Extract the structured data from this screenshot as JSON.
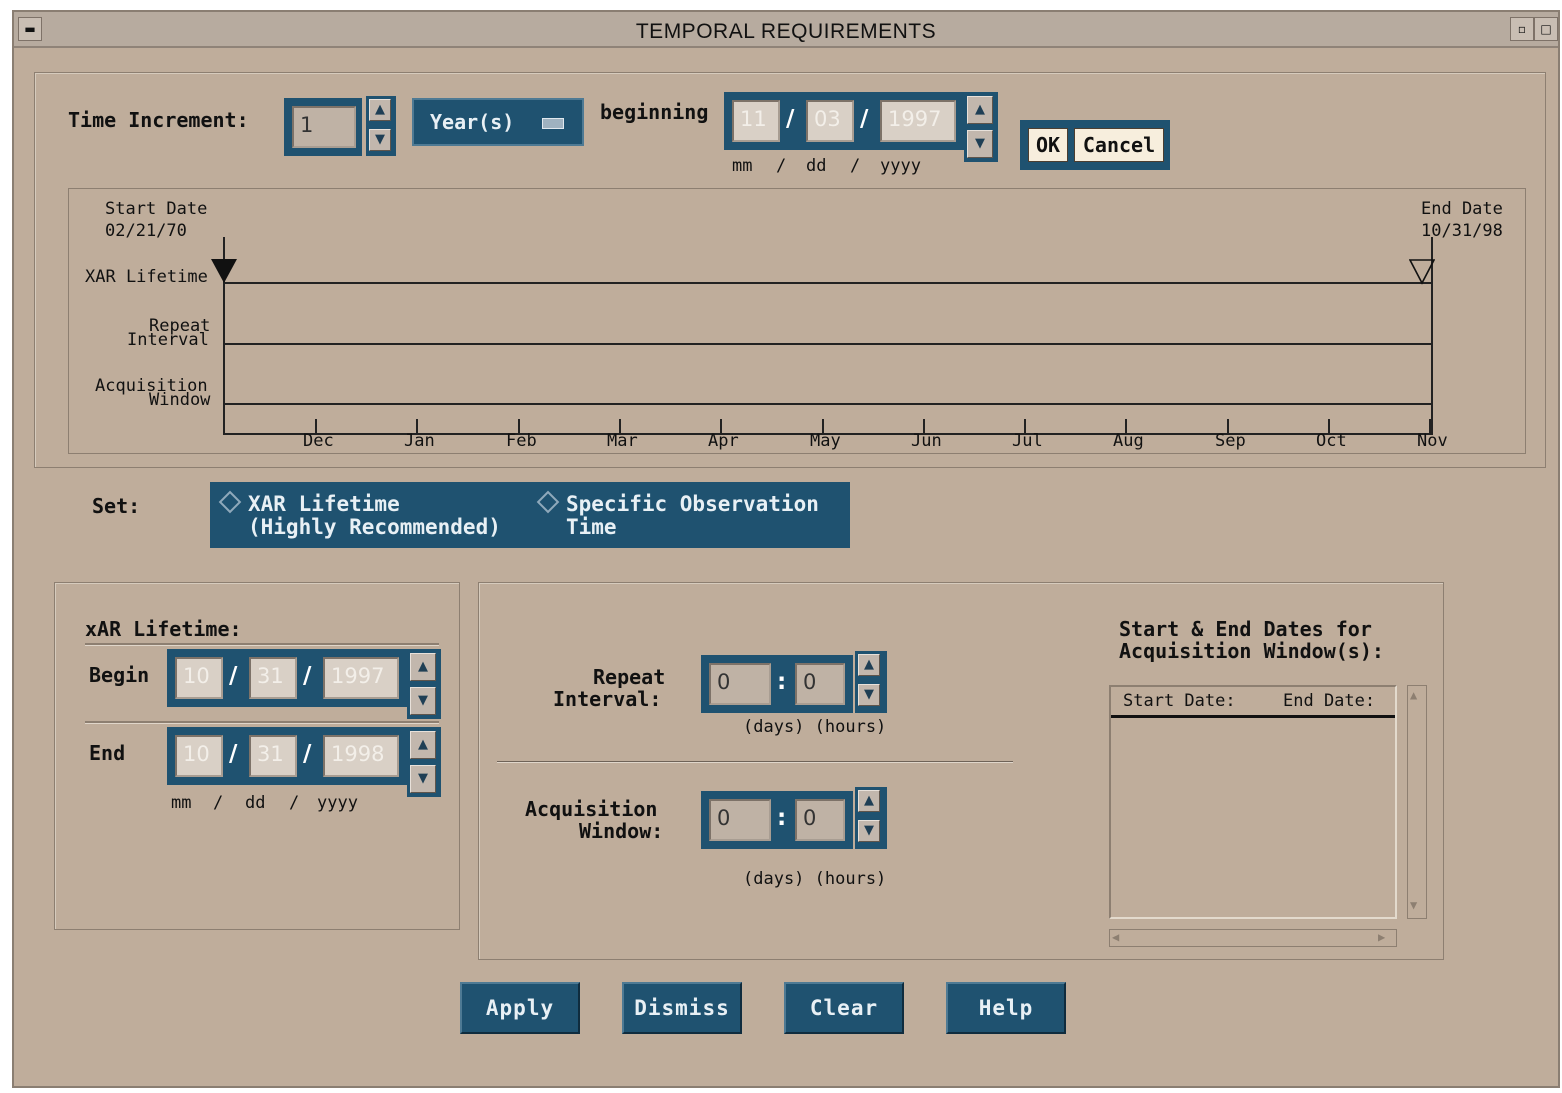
{
  "window": {
    "title": "TEMPORAL REQUIREMENTS"
  },
  "time_increment": {
    "label": "Time Increment:",
    "value": "1",
    "unit_selector": "Year(s)",
    "beginning_label": "beginning",
    "mm": "11",
    "dd": "03",
    "yyyy": "1997",
    "date_format": {
      "mm": "mm",
      "dd": "dd",
      "yyyy": "yyyy"
    },
    "ok_label": "OK",
    "cancel_label": "Cancel"
  },
  "timeline": {
    "start_label": "Start Date",
    "start_date": "02/21/70",
    "end_label": "End Date",
    "end_date": "10/31/98",
    "rows": {
      "lifetime": "XAR Lifetime",
      "repeat_1": "Repeat",
      "repeat_2": "Interval",
      "acq_1": "Acquisition",
      "acq_2": "Window"
    },
    "months": [
      "Dec",
      "Jan",
      "Feb",
      "Mar",
      "Apr",
      "May",
      "Jun",
      "Jul",
      "Aug",
      "Sep",
      "Oct",
      "Nov"
    ]
  },
  "set": {
    "label": "Set:",
    "option1_line1": "XAR Lifetime",
    "option1_line2": "(Highly Recommended)",
    "option2_line1": "Specific Observation",
    "option2_line2": "Time"
  },
  "lifetime": {
    "title": "xAR Lifetime:",
    "begin_label": "Begin",
    "end_label": "End",
    "begin": {
      "mm": "10",
      "dd": "31",
      "yyyy": "1997"
    },
    "end": {
      "mm": "10",
      "dd": "31",
      "yyyy": "1998"
    },
    "format": {
      "mm": "mm",
      "dd": "dd",
      "yyyy": "yyyy"
    }
  },
  "repeat": {
    "label1": "Repeat",
    "label2": "Interval:",
    "days": "0",
    "hours": "0",
    "units": "(days) (hours)"
  },
  "acquisition": {
    "label1": "Acquisition",
    "label2": "Window:",
    "days": "0",
    "hours": "0",
    "units": "(days) (hours)"
  },
  "windows_list": {
    "title1": "Start & End Dates for",
    "title2": "Acquisition Window(s):",
    "col_start": "Start Date:",
    "col_end": "End Date:"
  },
  "buttons": {
    "apply": "Apply",
    "dismiss": "Dismiss",
    "clear": "Clear",
    "help": "Help"
  },
  "colors": {
    "background": "#bfad9b",
    "field_frame": "#1f5270",
    "text_field": "#d9d0c6"
  }
}
